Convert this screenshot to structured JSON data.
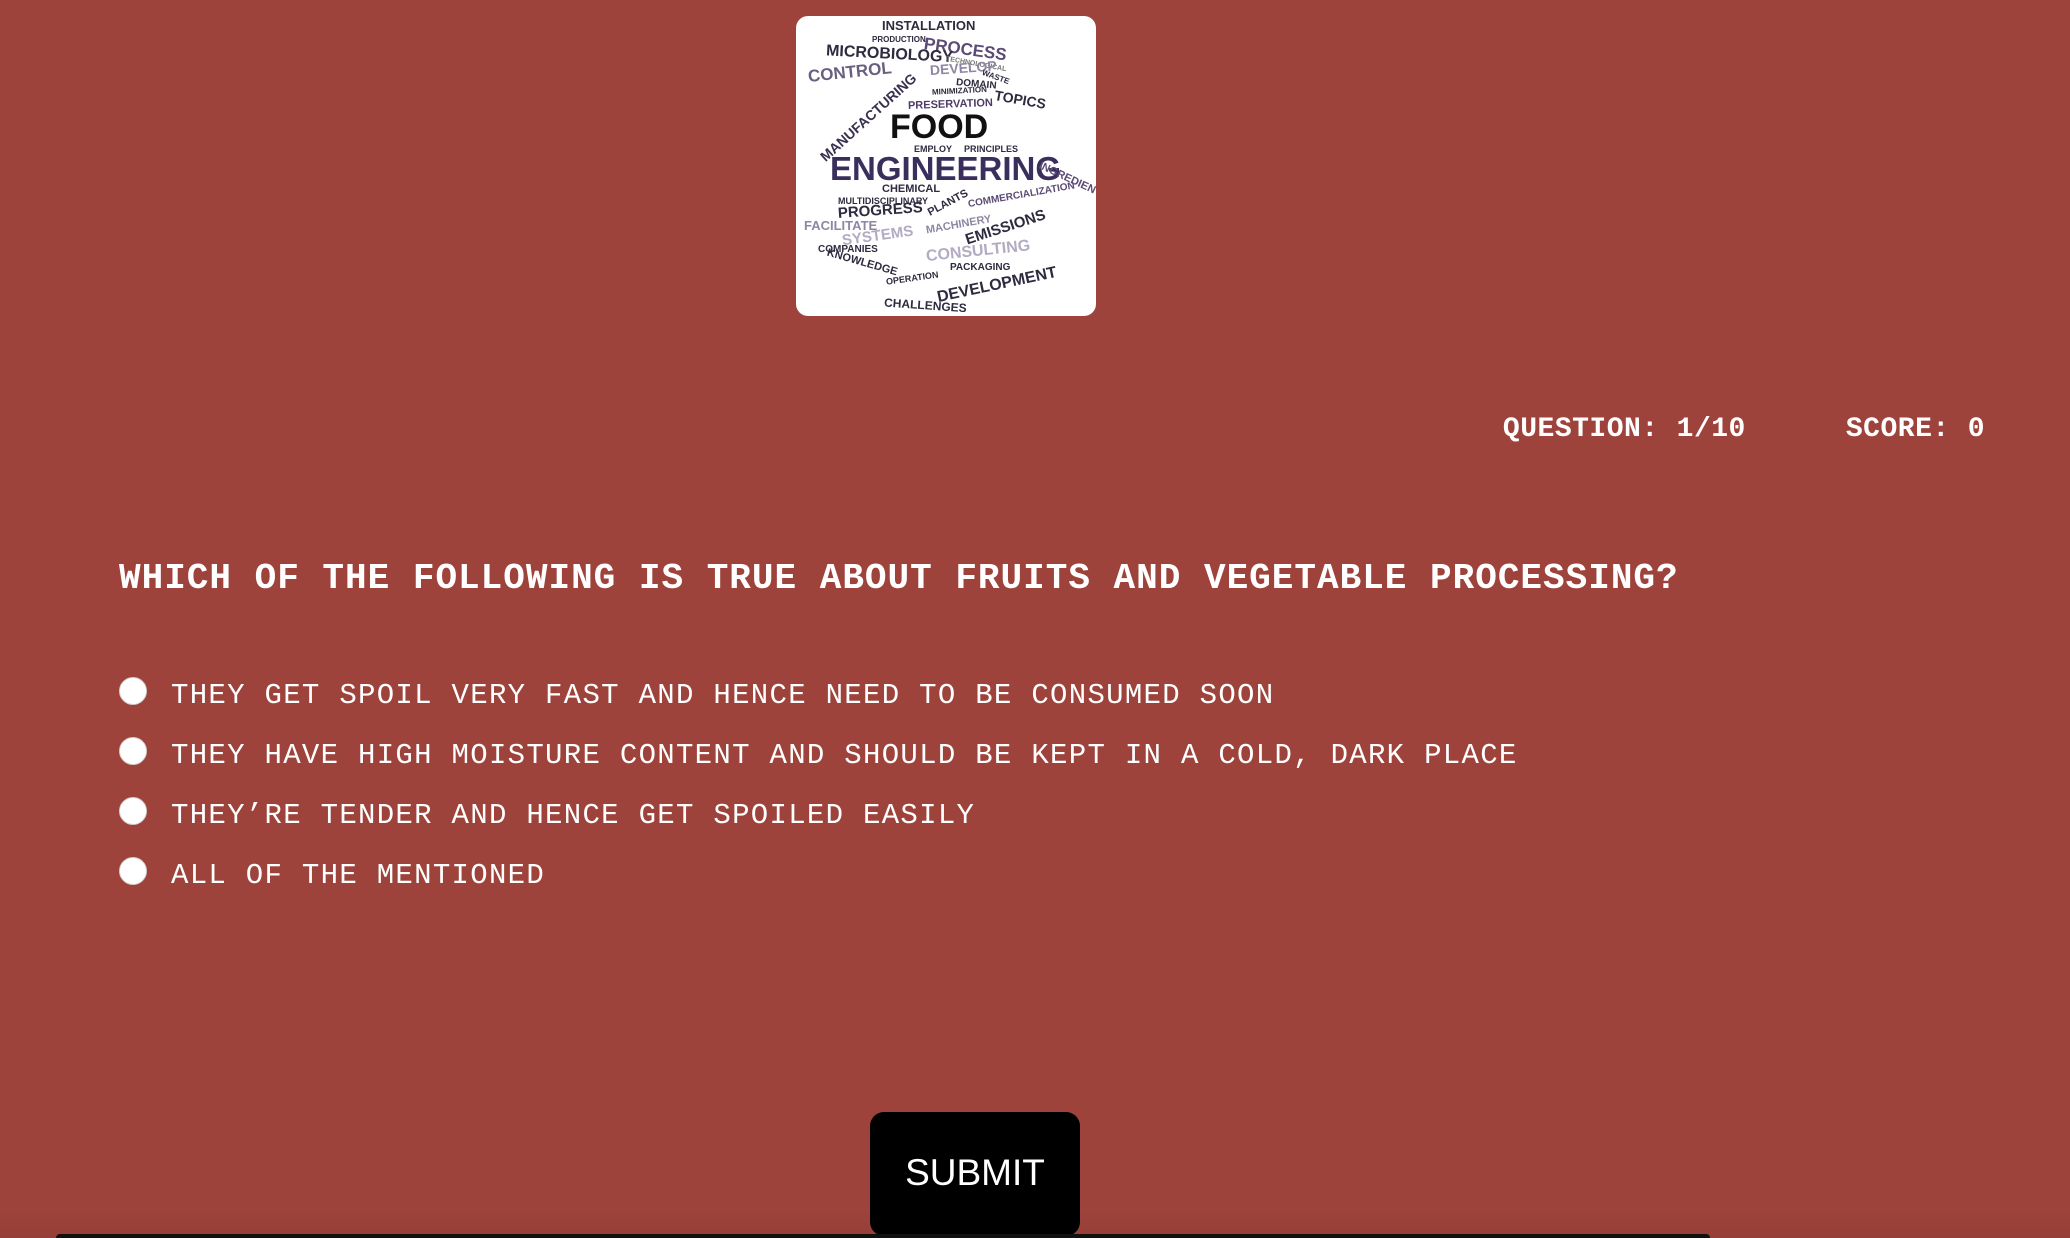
{
  "logo": {
    "alt": "Food Engineering word cloud",
    "words": [
      "INSTALLATION",
      "PRODUCTION",
      "PROCESS",
      "MICROBIOLOGY",
      "TECHNOLOGICAL",
      "CONTROL",
      "DEVELOP",
      "WASTE",
      "DOMAIN",
      "MANUFACTURING",
      "TOPICS",
      "MINIMIZATION",
      "PRESERVATION",
      "FOOD",
      "EMPLOY",
      "PRINCIPLES",
      "ENGINEERING",
      "INGREDIENT",
      "CHEMICAL",
      "MULTIDISCIPLINARY",
      "PLANTS",
      "COMMERCIALIZATION",
      "PROGRESS",
      "EMISSIONS",
      "FACILITATE",
      "SYSTEMS",
      "MACHINERY",
      "COMPANIES",
      "CONSULTING",
      "KNOWLEDGE",
      "PACKAGING",
      "OPERATION",
      "DEVELOPMENT",
      "CHALLENGES"
    ]
  },
  "status": {
    "question_label": "QUESTION:",
    "question_value": "1/10",
    "score_label": "SCORE:",
    "score_value": "0"
  },
  "question": {
    "text": "WHICH OF THE FOLLOWING IS TRUE ABOUT FRUITS AND VEGETABLE PROCESSING?"
  },
  "options": [
    {
      "label": "THEY GET SPOIL VERY FAST AND HENCE NEED TO BE CONSUMED SOON",
      "selected": false
    },
    {
      "label": "THEY HAVE HIGH MOISTURE CONTENT AND SHOULD BE KEPT IN A COLD, DARK PLACE",
      "selected": false
    },
    {
      "label": "THEY’RE TENDER AND HENCE GET SPOILED EASILY",
      "selected": false
    },
    {
      "label": "ALL OF THE MENTIONED",
      "selected": false
    }
  ],
  "submit": {
    "label": "SUBMIT"
  },
  "colors": {
    "background": "#9e433b",
    "button": "#000000",
    "text": "#ffffff",
    "logo_text": "#3a2f4d"
  }
}
